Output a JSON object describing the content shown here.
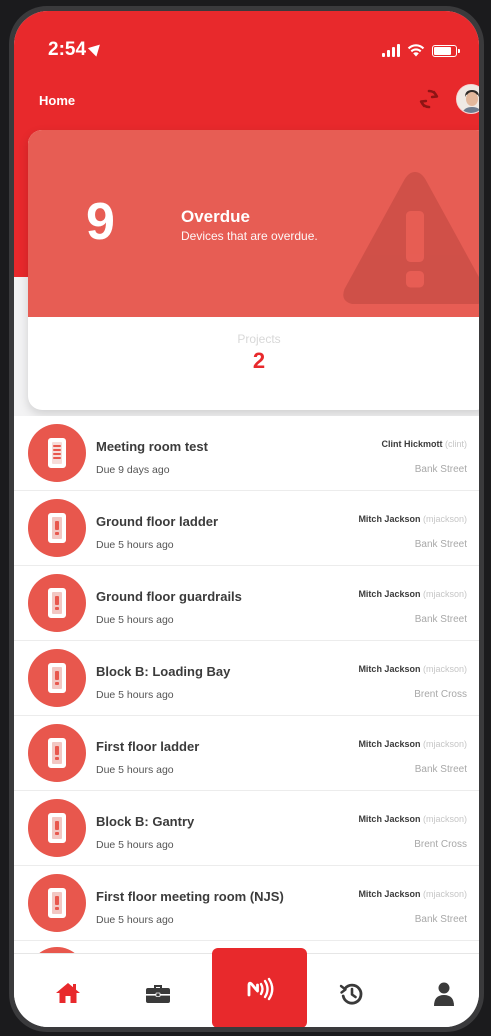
{
  "status_bar": {
    "time": "2:54"
  },
  "nav": {
    "title": "Home"
  },
  "summary": {
    "count": "9",
    "title": "Overdue",
    "subtitle": "Devices that are overdue.",
    "projects_label": "Projects",
    "projects_count": "2"
  },
  "items": [
    {
      "title": "Meeting room test",
      "due": "Due 9 days ago",
      "assignee": "Clint Hickmott",
      "username": "(clint)",
      "location": "Bank Street",
      "icon": "document-icon"
    },
    {
      "title": "Ground floor ladder",
      "due": "Due 5 hours ago",
      "assignee": "Mitch Jackson",
      "username": "(mjackson)",
      "location": "Bank Street",
      "icon": "device-alert-icon"
    },
    {
      "title": "Ground floor guardrails",
      "due": "Due 5 hours ago",
      "assignee": "Mitch Jackson",
      "username": "(mjackson)",
      "location": "Bank Street",
      "icon": "device-alert-icon"
    },
    {
      "title": "Block B: Loading Bay",
      "due": "Due 5 hours ago",
      "assignee": "Mitch Jackson",
      "username": "(mjackson)",
      "location": "Brent Cross",
      "icon": "device-alert-icon"
    },
    {
      "title": "First floor ladder",
      "due": "Due 5 hours ago",
      "assignee": "Mitch Jackson",
      "username": "(mjackson)",
      "location": "Bank Street",
      "icon": "device-alert-icon"
    },
    {
      "title": "Block B: Gantry",
      "due": "Due 5 hours ago",
      "assignee": "Mitch Jackson",
      "username": "(mjackson)",
      "location": "Brent Cross",
      "icon": "device-alert-icon"
    },
    {
      "title": "First floor meeting room (NJS)",
      "due": "Due 5 hours ago",
      "assignee": "Mitch Jackson",
      "username": "(mjackson)",
      "location": "Bank Street",
      "icon": "device-alert-icon"
    }
  ],
  "tabbar": {
    "tabs": [
      "home-icon",
      "briefcase-icon",
      "nfc-scan-icon",
      "history-icon",
      "user-icon"
    ],
    "active": "home-icon"
  },
  "colors": {
    "brand_red": "#e8292c",
    "card_red": "#e75d54",
    "icon_red": "#e8574d"
  }
}
